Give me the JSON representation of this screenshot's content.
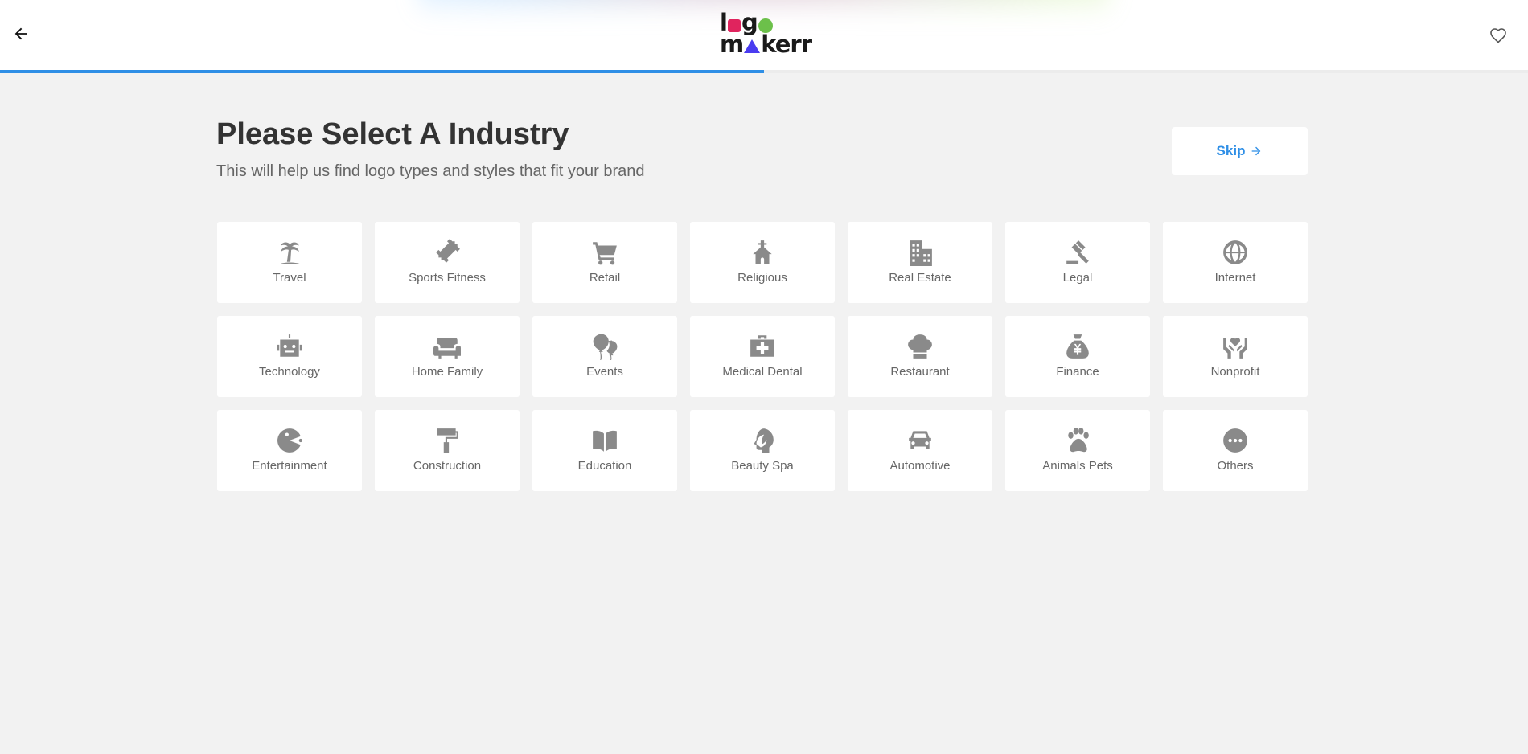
{
  "header": {
    "logo": {
      "row1": [
        "l",
        "g"
      ],
      "row2": [
        "m",
        "kerr"
      ]
    },
    "back_icon": "arrow-left-icon",
    "favorite_icon": "heart-outline-icon",
    "progress_fraction": 0.5
  },
  "main": {
    "title": "Please Select A Industry",
    "subtitle": "This will help us find logo types and styles that fit your brand",
    "skip_label": "Skip",
    "skip_icon": "arrow-right-icon"
  },
  "industries": [
    {
      "label": "Travel",
      "icon": "palm-tree-icon"
    },
    {
      "label": "Sports Fitness",
      "icon": "dumbbell-icon"
    },
    {
      "label": "Retail",
      "icon": "shopping-cart-icon"
    },
    {
      "label": "Religious",
      "icon": "church-icon"
    },
    {
      "label": "Real Estate",
      "icon": "building-icon"
    },
    {
      "label": "Legal",
      "icon": "gavel-icon"
    },
    {
      "label": "Internet",
      "icon": "globe-icon"
    },
    {
      "label": "Technology",
      "icon": "robot-icon"
    },
    {
      "label": "Home Family",
      "icon": "sofa-icon"
    },
    {
      "label": "Events",
      "icon": "balloons-icon"
    },
    {
      "label": "Medical Dental",
      "icon": "medical-kit-icon"
    },
    {
      "label": "Restaurant",
      "icon": "chef-hat-icon"
    },
    {
      "label": "Finance",
      "icon": "money-bag-icon"
    },
    {
      "label": "Nonprofit",
      "icon": "hands-heart-icon"
    },
    {
      "label": "Entertainment",
      "icon": "pacman-icon"
    },
    {
      "label": "Construction",
      "icon": "paint-roller-icon"
    },
    {
      "label": "Education",
      "icon": "open-book-icon"
    },
    {
      "label": "Beauty Spa",
      "icon": "leaf-face-icon"
    },
    {
      "label": "Automotive",
      "icon": "car-icon"
    },
    {
      "label": "Animals Pets",
      "icon": "paw-icon"
    },
    {
      "label": "Others",
      "icon": "more-dots-icon"
    }
  ],
  "colors": {
    "accent": "#2f8fe6",
    "background": "#f2f2f2",
    "icon": "#8a8a8a",
    "logo_square": "#e0245e",
    "logo_circle": "#6cc04a",
    "logo_triangle": "#4a3cf0"
  }
}
